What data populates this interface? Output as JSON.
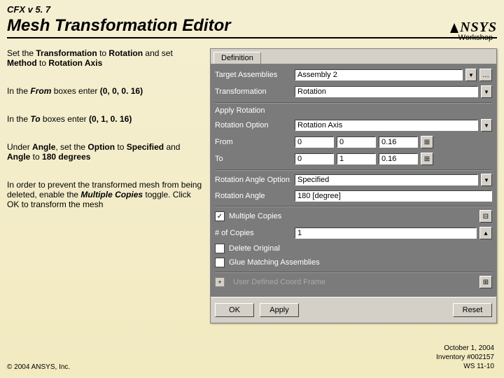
{
  "header": {
    "version": "CFX v 5. 7",
    "title": "Mesh Transformation Editor",
    "brand": "NSYS",
    "workshop": "Workshop"
  },
  "instructions": {
    "p1a": "Set the ",
    "p1b": "Transformation",
    "p1c": " to ",
    "p1d": "Rotation",
    "p1e": " and set ",
    "p1f": "Method",
    "p1g": " to ",
    "p1h": "Rotation Axis",
    "p2a": "In the ",
    "p2b": "From",
    "p2c": " boxes enter ",
    "p2d": "(0, 0, 0. 16)",
    "p3a": "In the ",
    "p3b": "To",
    "p3c": " boxes enter ",
    "p3d": "(0, 1, 0. 16)",
    "p4a": "Under ",
    "p4b": "Angle",
    "p4c": ", set the ",
    "p4d": "Option",
    "p4e": " to ",
    "p4f": "Specified",
    "p4g": " and ",
    "p4h": "Angle",
    "p4i": " to ",
    "p4j": "180 degrees",
    "p5a": "In order to prevent the transformed mesh from being deleted, enable the ",
    "p5b": "Multiple Copies",
    "p5c": " toggle.  Click OK to transform the mesh"
  },
  "dialog": {
    "tab": "Definition",
    "target_lbl": "Target Assemblies",
    "target_val": "Assembly 2",
    "trans_lbl": "Transformation",
    "trans_val": "Rotation",
    "applyrot": "Apply Rotation",
    "rotopt_lbl": "Rotation Option",
    "rotopt_val": "Rotation Axis",
    "from_lbl": "From",
    "from_x": "0",
    "from_y": "0",
    "from_z": "0.16",
    "to_lbl": "To",
    "to_x": "0",
    "to_y": "1",
    "to_z": "0.16",
    "angopt_lbl": "Rotation Angle Option",
    "angopt_val": "Specified",
    "ang_lbl": "Rotation Angle",
    "ang_val": "180 [degree]",
    "mult": "Multiple Copies",
    "copies_lbl": "# of Copies",
    "copies_val": "1",
    "delorig": "Delete Original",
    "glue": "Glue Matching Assemblies",
    "coord": "User Defined Coord Frame",
    "ok": "OK",
    "apply": "Apply",
    "reset": "Reset"
  },
  "footer": {
    "copyright": "© 2004 ANSYS, Inc.",
    "date": "October 1, 2004",
    "inv": "Inventory #002157",
    "ws": "WS 11-10"
  }
}
